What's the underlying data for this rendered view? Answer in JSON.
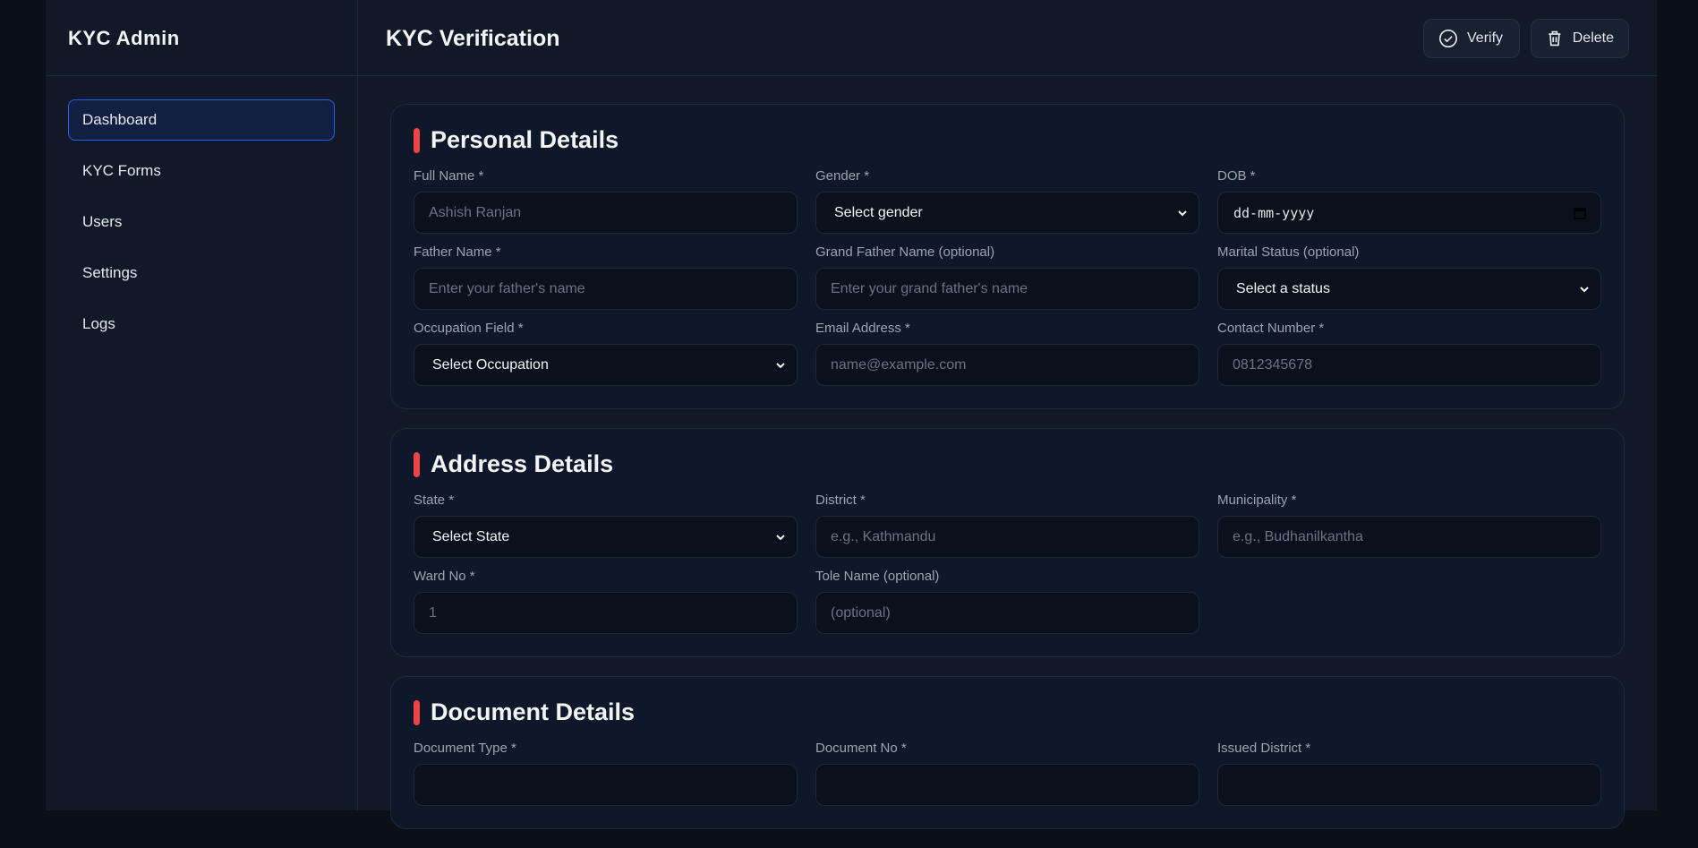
{
  "sidebar": {
    "brand": "KYC Admin",
    "items": [
      {
        "label": "Dashboard",
        "active": true
      },
      {
        "label": "KYC Forms"
      },
      {
        "label": "Users"
      },
      {
        "label": "Settings"
      },
      {
        "label": "Logs"
      }
    ]
  },
  "header": {
    "title": "KYC Verification",
    "verify_label": "Verify",
    "delete_label": "Delete"
  },
  "personal": {
    "heading": "Personal Details",
    "fields": [
      {
        "label": "Full Name *",
        "placeholder": "Ashish Ranjan"
      },
      {
        "label": "Gender *",
        "value": "Select gender"
      },
      {
        "label": "DOB *",
        "value": "dd-mm-yyyy"
      },
      {
        "label": "Father Name *",
        "placeholder": "Enter your father's name"
      },
      {
        "label": "Grand Father Name (optional)",
        "placeholder": "Enter your grand father's name"
      },
      {
        "label": "Marital Status (optional)",
        "value": "Select a status"
      },
      {
        "label": "Occupation Field *",
        "value": "Select Occupation"
      },
      {
        "label": "Email Address *",
        "placeholder": "name@example.com"
      },
      {
        "label": "Contact Number *",
        "placeholder": "0812345678"
      }
    ]
  },
  "address": {
    "heading": "Address Details",
    "fields": [
      {
        "label": "State *",
        "value": "Select State"
      },
      {
        "label": "District *",
        "placeholder": "e.g., Kathmandu"
      },
      {
        "label": "Municipality *",
        "placeholder": "e.g., Budhanilkantha"
      },
      {
        "label": "Ward No *",
        "placeholder": "1"
      },
      {
        "label": "Tole Name (optional)",
        "placeholder": "(optional)"
      }
    ]
  },
  "document": {
    "heading": "Document Details",
    "fields": [
      {
        "label": "Document Type *"
      },
      {
        "label": "Document No *"
      },
      {
        "label": "Issued District *"
      }
    ]
  },
  "colors": {
    "accent": "#2563eb",
    "section_marker": "#ef4444"
  }
}
